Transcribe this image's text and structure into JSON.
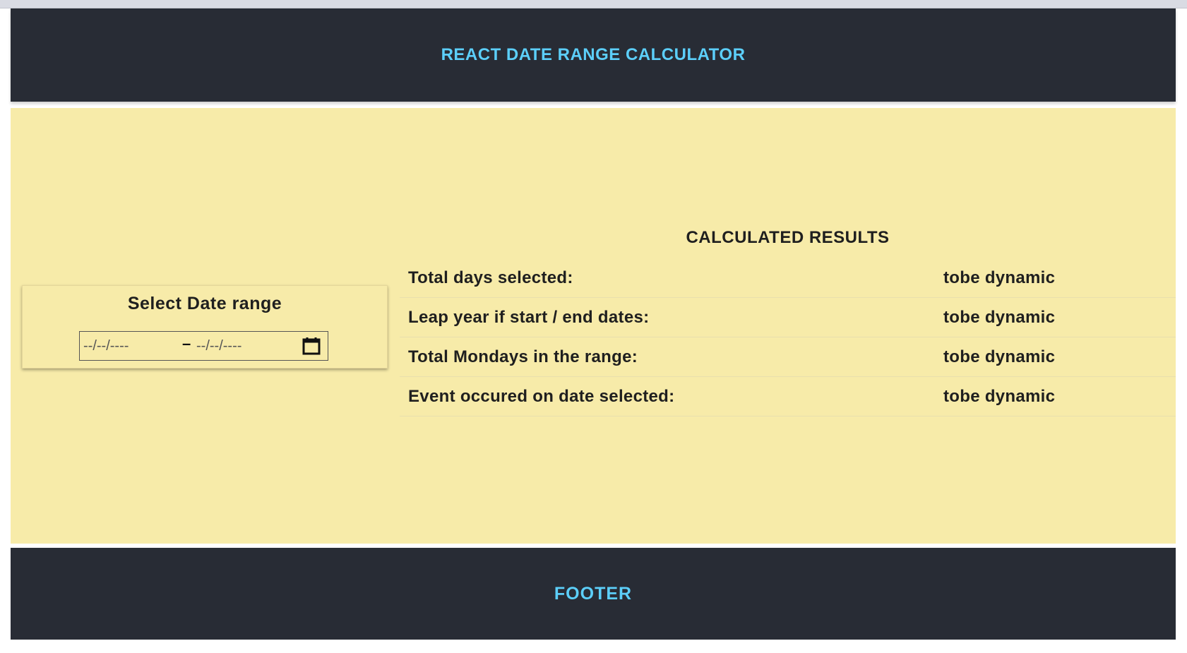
{
  "header": {
    "title": "REACT DATE RANGE CALCULATOR"
  },
  "date_range": {
    "title": "Select Date range",
    "start_placeholder": "--/--/----",
    "separator": "–",
    "end_placeholder": "--/--/----",
    "icon": "calendar-icon"
  },
  "results": {
    "title": "CALCULATED RESULTS",
    "rows": [
      {
        "label": "Total days selected:",
        "value": "tobe dynamic"
      },
      {
        "label": "Leap year if start / end dates:",
        "value": "tobe dynamic"
      },
      {
        "label": "Total Mondays in the range:",
        "value": "tobe dynamic"
      },
      {
        "label": "Event occured on date selected:",
        "value": "tobe dynamic"
      }
    ]
  },
  "footer": {
    "title": "FOOTER"
  },
  "colors": {
    "header_bg": "#282c35",
    "accent": "#5ccffa",
    "main_bg": "#f7eba9"
  }
}
